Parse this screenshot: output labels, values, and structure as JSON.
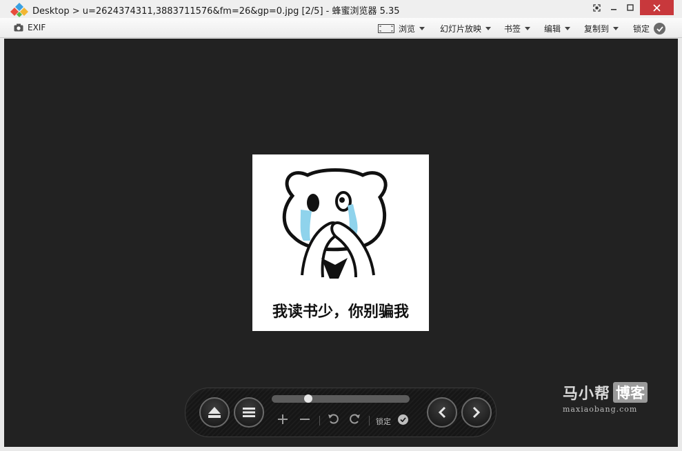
{
  "window": {
    "title": "Desktop > u=2624374311,3883711576&fm=26&gp=0.jpg [2/5] - 蜂蜜浏览器 5.35"
  },
  "toolbar": {
    "exif_label": "EXIF",
    "browse_label": "浏览",
    "slideshow_label": "幻灯片放映",
    "bookmark_label": "书签",
    "edit_label": "编辑",
    "copyto_label": "复制到",
    "lock_label": "锁定"
  },
  "image": {
    "caption": "我读书少，你别骗我"
  },
  "watermark": {
    "brand": "马小帮",
    "blog": "博客",
    "url": "maxiaobang.com"
  },
  "controls": {
    "lock_label": "锁定",
    "zoom_position": 0.25
  },
  "colors": {
    "close_button": "#c8383c",
    "viewer_background": "#222222"
  }
}
